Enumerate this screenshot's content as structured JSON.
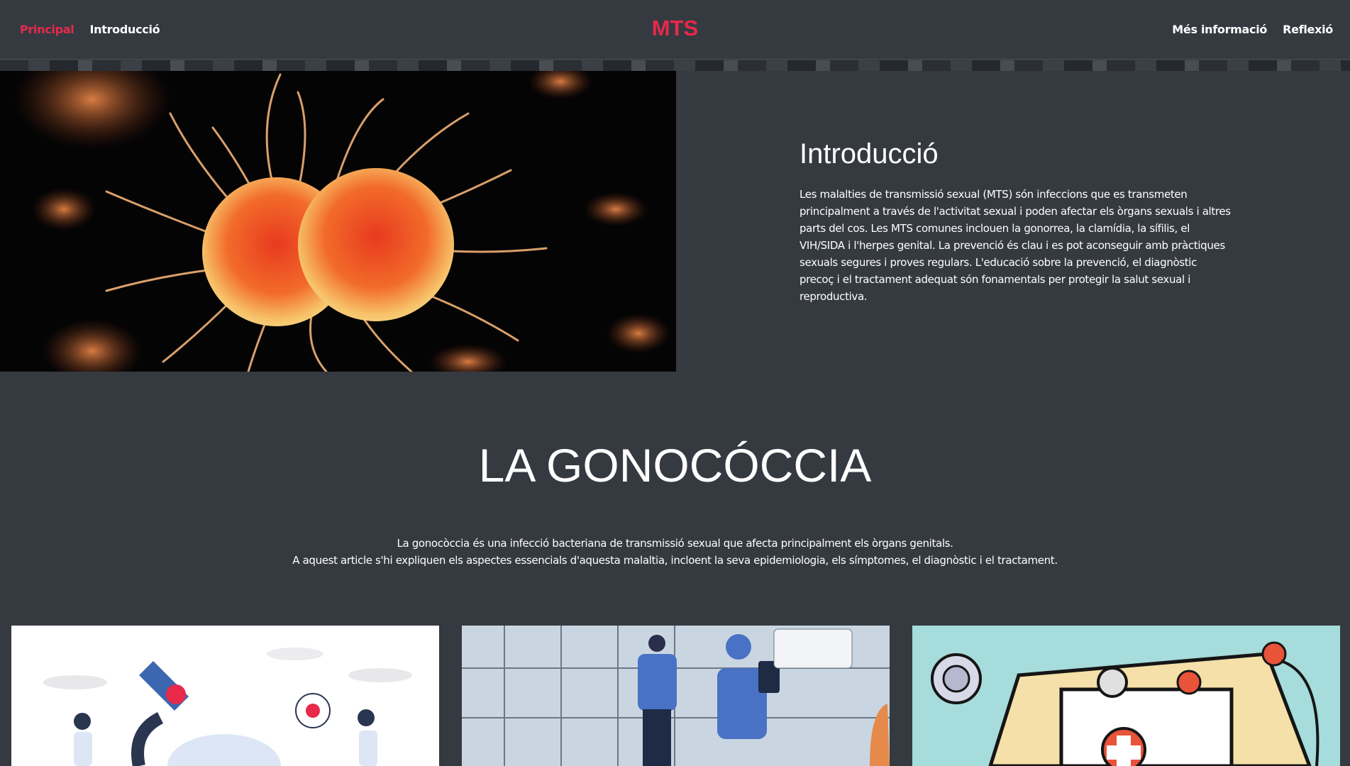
{
  "nav": {
    "left": [
      {
        "label": "Principal",
        "active": true
      },
      {
        "label": "Introducció",
        "active": false
      }
    ],
    "brand": "MTS",
    "right": [
      {
        "label": "Més informació"
      },
      {
        "label": "Reflexió"
      }
    ]
  },
  "colors": {
    "accent": "#e8294a",
    "background": "#353a41",
    "text": "#ffffff"
  },
  "intro": {
    "title": "Introducció",
    "body": "Les malalties de transmissió sexual (MTS) són infeccions que es transmeten principalment a través de l'activitat sexual i poden afectar els òrgans sexuals i altres parts del cos. Les MTS comunes inclouen la gonorrea, la clamídia, la sífilis, el VIH/SIDA i l'herpes genital. La prevenció és clau i es pot aconseguir amb pràctiques sexuals segures i proves regulars. L'educació sobre la prevenció, el diagnòstic precoç i el tractament adequat són fonamentals per protegir la salut sexual i reproductiva."
  },
  "section": {
    "title": "LA GONOCÓCCIA",
    "desc_line1": "La gonocòccia és una infecció bacteriana de transmissió sexual que afecta principalment els òrgans genitals.",
    "desc_line2": "A aquest article s'hi expliquen els aspectes essencials d'aquesta malaltia, incloent la seva epidemiologia, els símptomes, el diagnòstic i el tractament."
  },
  "images": {
    "hero": "bacteria-illustration",
    "cards": [
      "lab-microscope-illustration",
      "medical-staff-illustration",
      "clipboard-stethoscope-illustration"
    ]
  }
}
